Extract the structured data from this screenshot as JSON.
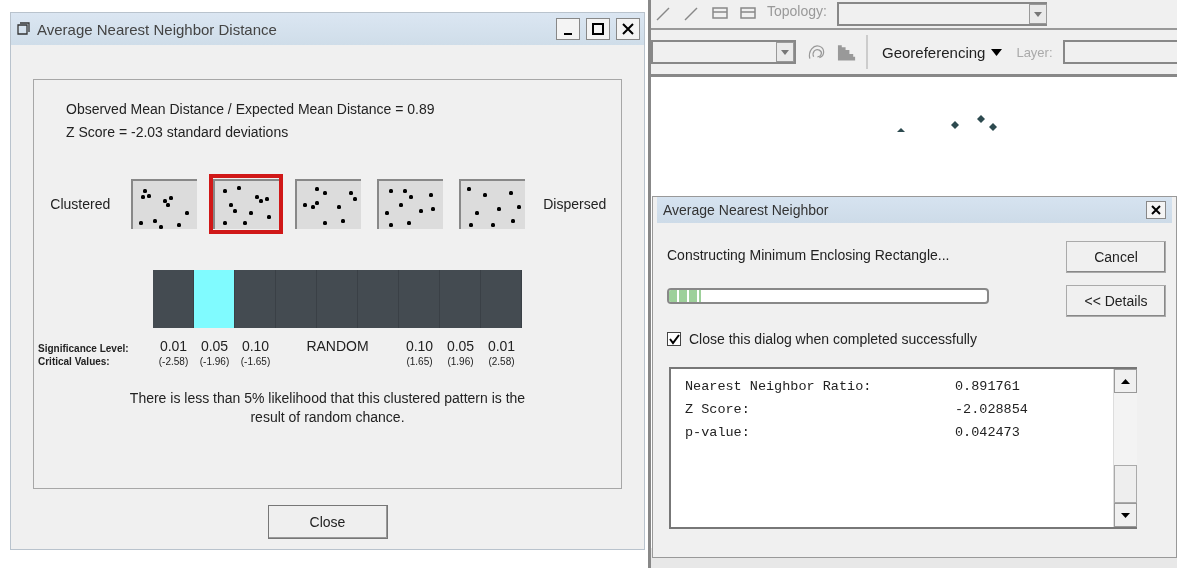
{
  "stats_window": {
    "title": "Average Nearest Neighbor Distance",
    "summary_lines": [
      "Observed Mean Distance / Expected Mean Distance = 0.89",
      "Z Score = -2.03 standard deviations"
    ],
    "left_label": "Clustered",
    "right_label": "Dispersed",
    "patterns": [
      {
        "selected": false
      },
      {
        "selected": true
      },
      {
        "selected": false
      },
      {
        "selected": false
      },
      {
        "selected": false
      }
    ],
    "bar_cells": [
      {
        "selected": false
      },
      {
        "selected": true
      },
      {
        "selected": false
      },
      {
        "selected": false
      },
      {
        "selected": false
      },
      {
        "selected": false
      },
      {
        "selected": false
      },
      {
        "selected": false
      },
      {
        "selected": false
      }
    ],
    "significance_label": "Significance Level:",
    "critical_label": "Critical Values:",
    "scale": [
      {
        "kind": "value",
        "significance": "0.01",
        "critical": "(-2.58)"
      },
      {
        "kind": "value",
        "significance": "0.05",
        "critical": "(-1.96)"
      },
      {
        "kind": "value",
        "significance": "0.10",
        "critical": "(-1.65)"
      },
      {
        "kind": "random",
        "significance": "RANDOM"
      },
      {
        "kind": "value",
        "significance": "0.10",
        "critical": "(1.65)"
      },
      {
        "kind": "value",
        "significance": "0.05",
        "critical": "(1.96)"
      },
      {
        "kind": "value",
        "significance": "0.01",
        "critical": "(2.58)"
      }
    ],
    "message": "There is less than 5% likelihood that this clustered pattern is the result of random chance.",
    "close_button": "Close"
  },
  "toolbar": {
    "topology_label": "Topology:",
    "georeferencing_menu": "Georeferencing",
    "layer_label": "Layer:"
  },
  "progress_window": {
    "title": "Average Nearest Neighbor",
    "status": "Constructing Minimum Enclosing Rectangle...",
    "progress": {
      "level": 0.1
    },
    "buttons": [
      "Cancel",
      "<< Details"
    ],
    "close_when_done": {
      "label": "Close this dialog when completed successfully",
      "checked": true
    },
    "results": [
      {
        "label": "Nearest Neighbor Ratio:",
        "value": "0.891761"
      },
      {
        "label": "Z Score:",
        "value": "-2.028854"
      },
      {
        "label": "p-value:",
        "value": "0.042473"
      }
    ]
  }
}
